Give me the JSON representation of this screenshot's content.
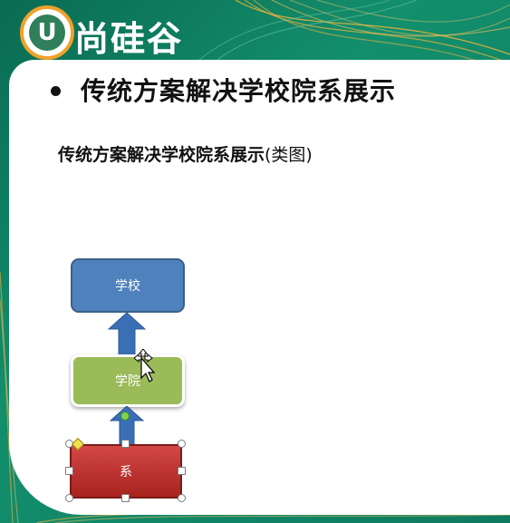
{
  "logo": {
    "badge_letter": "U",
    "text": "尚硅谷"
  },
  "slide": {
    "title": "传统方案解决学校院系展示",
    "subtitle_bold": "传统方案解决学校院系展示",
    "subtitle_suffix": "(类图)"
  },
  "diagram": {
    "nodes": [
      {
        "id": "school",
        "label": "学校",
        "color": "#4f81bd"
      },
      {
        "id": "college",
        "label": "学院",
        "color": "#9bbb59"
      },
      {
        "id": "department",
        "label": "系",
        "color": "#c0392b"
      }
    ],
    "arrow_color": "#3a6fb5",
    "selected_node": "department"
  },
  "colors": {
    "background": "#0f7a5f",
    "accent_orange": "#f0a12a",
    "panel": "#ffffff"
  },
  "icons": {
    "cursor": "move-cursor-icon",
    "bullet": "bullet-dot-icon"
  }
}
